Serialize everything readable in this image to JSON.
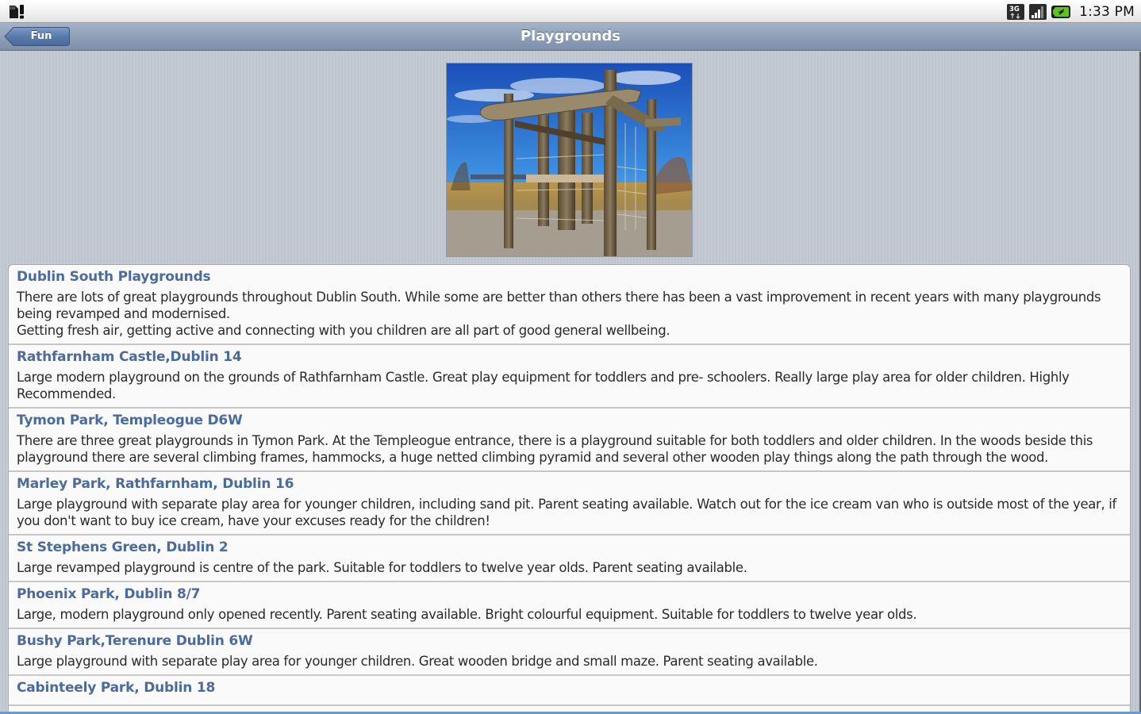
{
  "status_bar": {
    "icons": [
      "sd-card-warning-icon",
      "3g-data-icon",
      "signal-strength-icon",
      "battery-charging-icon"
    ],
    "time": "1:33 PM"
  },
  "title_bar": {
    "back_label": "Fun",
    "title": "Playgrounds"
  },
  "hero_image": {
    "alt": "Wooden climbing frame playground under blue sky"
  },
  "colors": {
    "title_bar": "#8fa0b8",
    "item_title": "#4a6b9b",
    "body_text": "#2a2a2a",
    "list_bg": "#fafafa"
  },
  "items": [
    {
      "title": "Dublin South Playgrounds",
      "body": "There are lots of great playgrounds throughout Dublin South. While some are better than others there has been a vast improvement in recent years with many playgrounds being revamped and modernised.\nGetting fresh air, getting active and connecting with you children are all part of good general wellbeing."
    },
    {
      "title": "Rathfarnham Castle,Dublin 14",
      "body": "Large modern playground on the grounds of Rathfarnham Castle. Great play equipment for toddlers and pre- schoolers. Really large play area for older children. Highly Recommended."
    },
    {
      "title": "Tymon Park, Templeogue D6W",
      "body": "There are three great playgrounds in Tymon Park. At the Templeogue entrance, there is a playground suitable for both toddlers and older children. In the woods beside this playground there are several climbing frames, hammocks, a huge netted climbing pyramid and several other wooden play things along the path through the wood."
    },
    {
      "title": "Marley Park, Rathfarnham, Dublin 16",
      "body": "Large playground with separate play area for younger children, including sand pit. Parent seating available. Watch out for the ice cream van who is outside most of the year, if you don't want to buy ice cream, have your excuses ready for the children!"
    },
    {
      "title": "St Stephens Green, Dublin 2",
      "body": "Large revamped playground is centre of the park. Suitable for toddlers to twelve year olds. Parent seating available."
    },
    {
      "title": "Phoenix Park, Dublin 8/7",
      "body": "Large, modern playground only opened recently. Parent seating available. Bright colourful equipment. Suitable for toddlers to twelve year olds."
    },
    {
      "title": "Bushy Park,Terenure Dublin 6W",
      "body": "Large playground with separate play area for younger children. Great wooden bridge and small maze. Parent seating available."
    },
    {
      "title": "Cabinteely Park, Dublin 18",
      "body": ""
    }
  ]
}
